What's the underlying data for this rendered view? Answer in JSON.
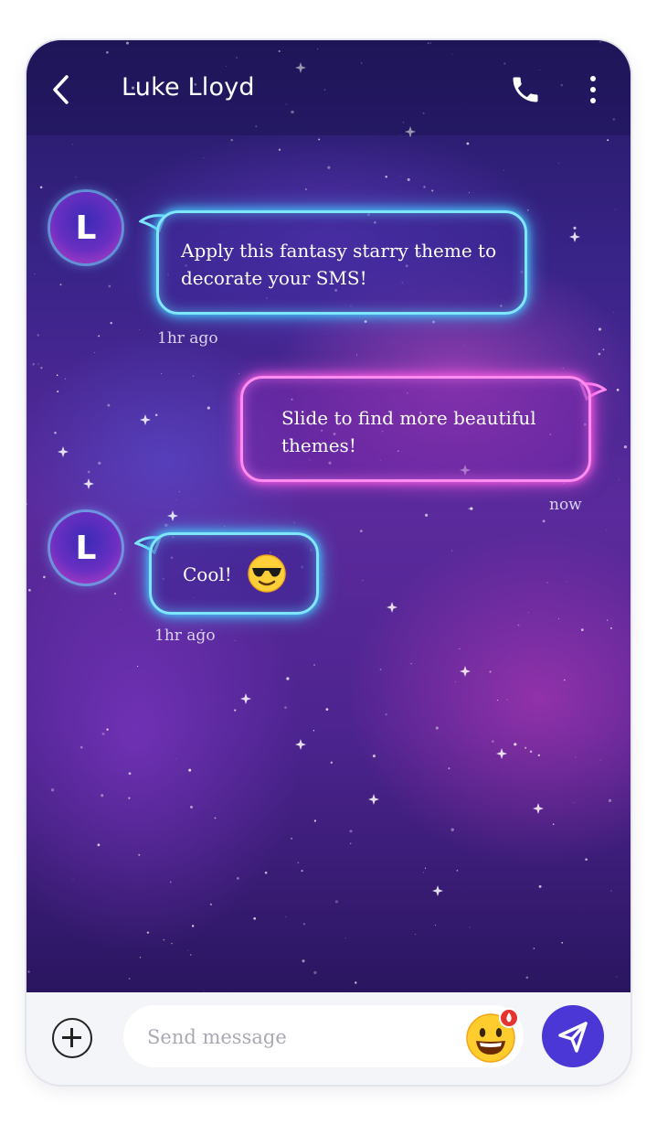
{
  "header": {
    "title": "Luke Lloyd",
    "back_icon": "chevron-left-icon",
    "call_icon": "phone-icon",
    "more_icon": "more-vertical-icon"
  },
  "messages": [
    {
      "direction": "incoming",
      "avatar_initial": "L",
      "text": "Apply this fantasy starry theme to decorate your SMS!",
      "time": "1hr ago"
    },
    {
      "direction": "outgoing",
      "text": "Slide to find more beautiful themes!",
      "time": "now"
    },
    {
      "direction": "incoming",
      "avatar_initial": "L",
      "text": "Cool!",
      "emoji": "sunglasses-emoji",
      "time": "1hr ago"
    }
  ],
  "composer": {
    "add_icon": "plus-circle-icon",
    "placeholder": "Send message",
    "emoji_icon": "grinning-face-icon",
    "send_icon": "send-icon"
  },
  "colors": {
    "incoming_bubble_glow": "#7fe6ff",
    "outgoing_bubble_glow": "#ff8cf0",
    "send_button": "#4b37d6",
    "composer_bg": "#f4f5f8"
  }
}
